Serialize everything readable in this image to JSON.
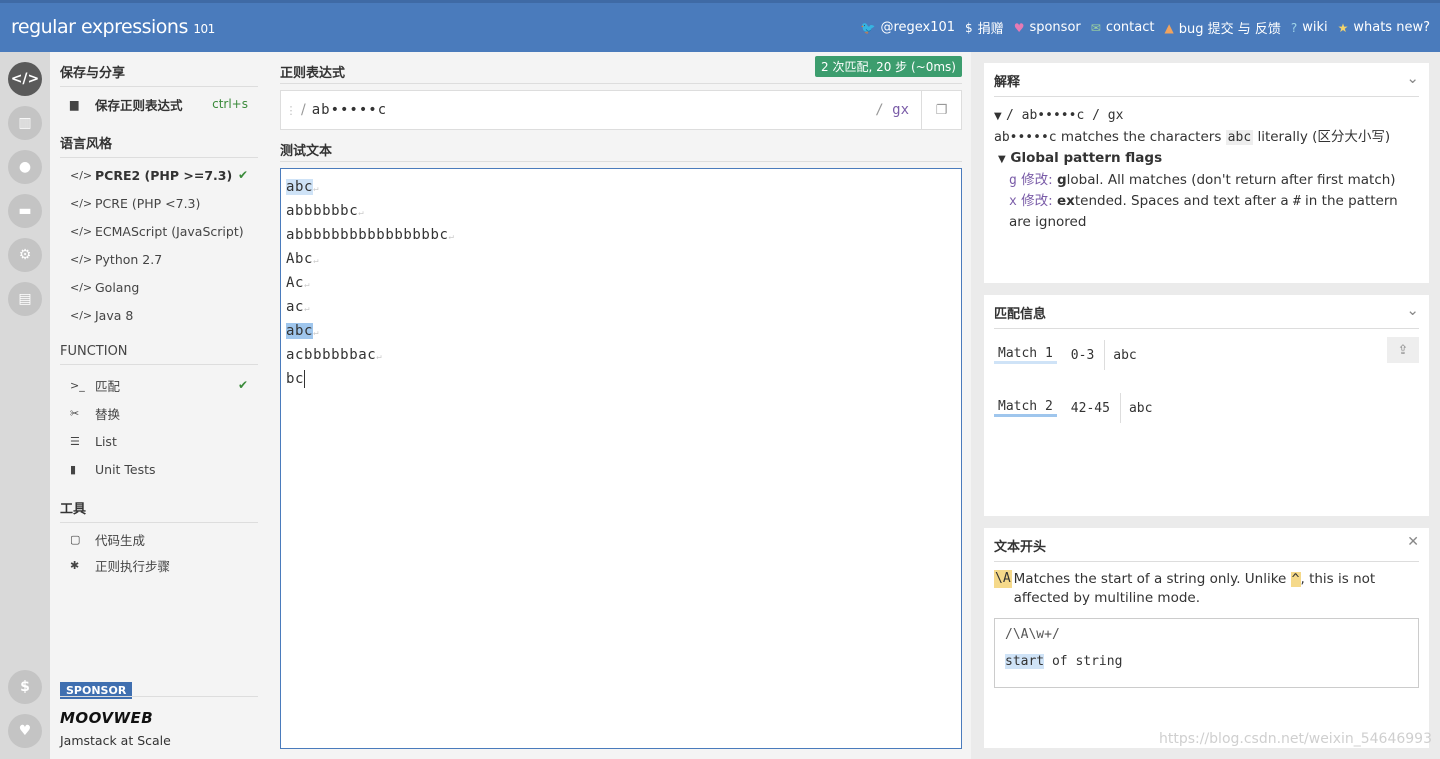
{
  "header": {
    "brand": "regular expressions",
    "brand_suffix": "101",
    "links": [
      {
        "icon": "twitter-icon",
        "glyph": "🐦",
        "label": "@regex101"
      },
      {
        "icon": "dollar-icon",
        "glyph": "$",
        "label": "捐赠"
      },
      {
        "icon": "heart-icon",
        "glyph": "♥",
        "label": "sponsor"
      },
      {
        "icon": "mail-icon",
        "glyph": "✉",
        "label": "contact"
      },
      {
        "icon": "warning-icon",
        "glyph": "▲",
        "label": "bug 提交 与 反馈"
      },
      {
        "icon": "wiki-icon",
        "glyph": "?",
        "label": "wiki"
      },
      {
        "icon": "whats-new-icon",
        "glyph": "★",
        "label": "whats new?"
      }
    ]
  },
  "sidebar": {
    "save_title": "保存与分享",
    "save_label": "保存正则表达式",
    "save_shortcut": "ctrl+s",
    "flavor_title": "语言风格",
    "flavors": [
      "PCRE2 (PHP >=7.3)",
      "PCRE (PHP <7.3)",
      "ECMAScript (JavaScript)",
      "Python 2.7",
      "Golang",
      "Java 8"
    ],
    "function_title": "FUNCTION",
    "functions": [
      "匹配",
      "替换",
      "List",
      "Unit Tests"
    ],
    "tools_title": "工具",
    "tools": [
      "代码生成",
      "正则执行步骤"
    ],
    "sponsor_label": "SPONSOR",
    "sponsor_name": "MOOVWEB",
    "sponsor_tagline": "Jamstack at Scale"
  },
  "regex": {
    "title": "正则表达式",
    "match_badge": "2 次匹配, 20 步 (~0ms)",
    "delimiter": "/",
    "pattern": "ab•••••c",
    "flags": "gx"
  },
  "test": {
    "title": "测试文本",
    "lines": [
      "abc",
      "abbbbbbc",
      "abbbbbbbbbbbbbbbbc",
      "Abc",
      "Ac",
      "ac",
      "abc",
      "acbbbbbbac",
      "bc"
    ]
  },
  "explanation": {
    "title": "解释",
    "root": "/ ab•••••c / gx",
    "token": "ab•••••c",
    "desc_a": " matches the characters ",
    "literal": "abc",
    "desc_b": " literally (区分大小写)",
    "flags_title": "Global pattern flags",
    "flag_g_letter": "g",
    "flag_g_mod": "修改:",
    "flag_g_bold": "g",
    "flag_g_text": "lobal. All matches (don't return after first match)",
    "flag_x_letter": "x",
    "flag_x_mod": "修改:",
    "flag_x_bold": "ex",
    "flag_x_text": "tended. Spaces and text after a ",
    "flag_x_hash": "#",
    "flag_x_text2": " in the pattern are ignored"
  },
  "match_info": {
    "title": "匹配信息",
    "matches": [
      {
        "name": "Match 1",
        "range": "0-3",
        "value": "abc"
      },
      {
        "name": "Match 2",
        "range": "42-45",
        "value": "abc"
      }
    ]
  },
  "reference": {
    "title": "文本开头",
    "token": "\\A",
    "text_a": " Matches the start of a string only. Unlike ",
    "caret": "^",
    "text_b": ", this is not affected by multiline mode.",
    "example_pattern": "/\\A\\w+/",
    "example_match": "start",
    "example_rest": " of string"
  },
  "watermark": "https://blog.csdn.net/weixin_54646993"
}
